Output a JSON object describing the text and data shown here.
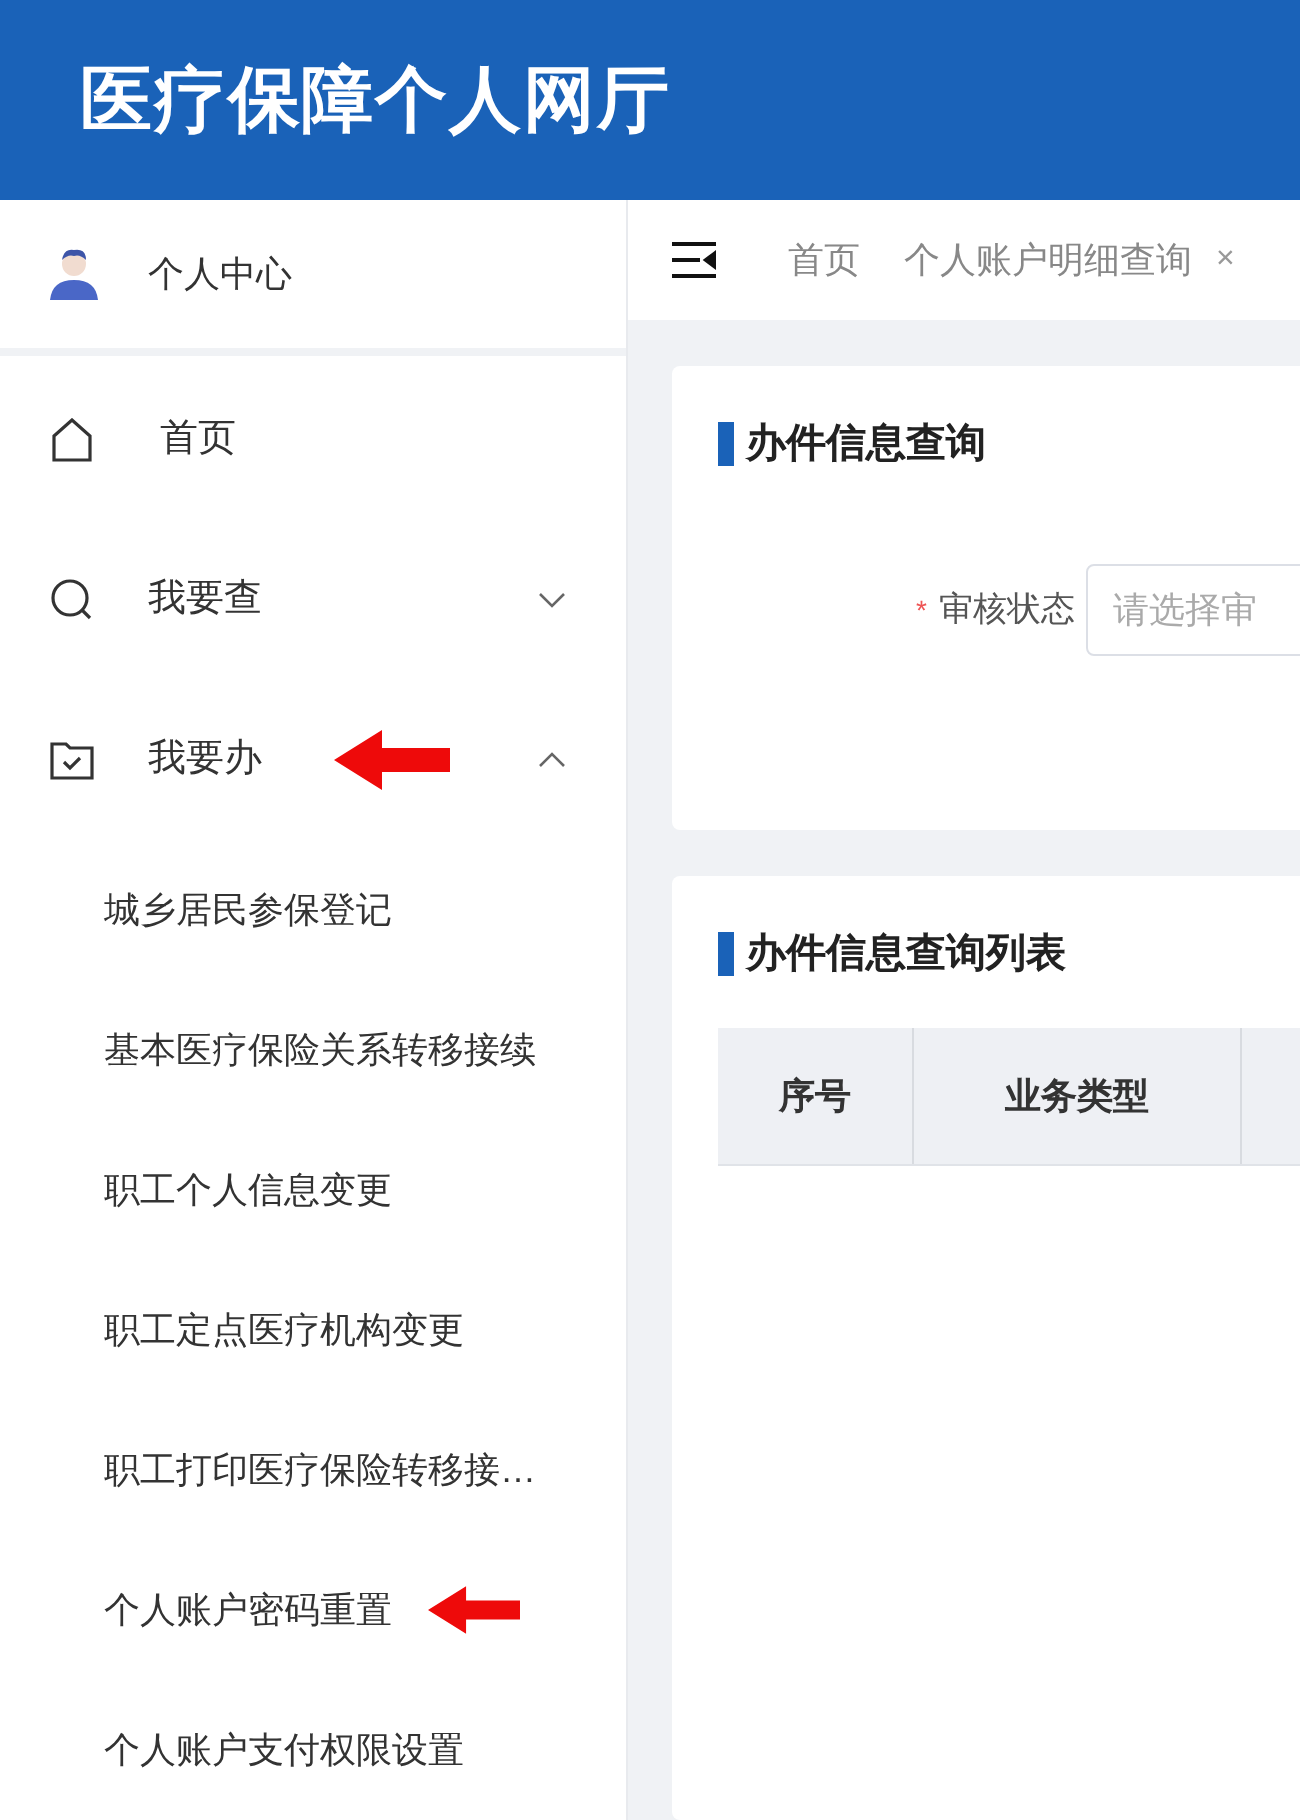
{
  "header": {
    "title": "医疗保障个人网厅"
  },
  "sidebar": {
    "profile": {
      "label": "个人中心"
    },
    "items": [
      {
        "kind": "link",
        "label": "首页"
      },
      {
        "kind": "group",
        "label": "我要查",
        "expanded": false,
        "annotated": false
      },
      {
        "kind": "group",
        "label": "我要办",
        "expanded": true,
        "annotated": true,
        "children": [
          {
            "label": "城乡居民参保登记",
            "annotated": false
          },
          {
            "label": "基本医疗保险关系转移接续",
            "annotated": false
          },
          {
            "label": "职工个人信息变更",
            "annotated": false
          },
          {
            "label": "职工定点医疗机构变更",
            "annotated": false
          },
          {
            "label": "职工打印医疗保险转移接…",
            "annotated": false
          },
          {
            "label": "个人账户密码重置",
            "annotated": true
          },
          {
            "label": "个人账户支付权限设置",
            "annotated": false
          }
        ]
      }
    ]
  },
  "tabs": [
    {
      "label": "首页"
    },
    {
      "label": "个人账户明细查询",
      "close": "×"
    }
  ],
  "query_card": {
    "title": "办件信息查询",
    "field": {
      "required_mark": "*",
      "label": "审核状态",
      "placeholder": "请选择审"
    }
  },
  "list_card": {
    "title": "办件信息查询列表",
    "columns": [
      "序号",
      "业务类型"
    ]
  }
}
